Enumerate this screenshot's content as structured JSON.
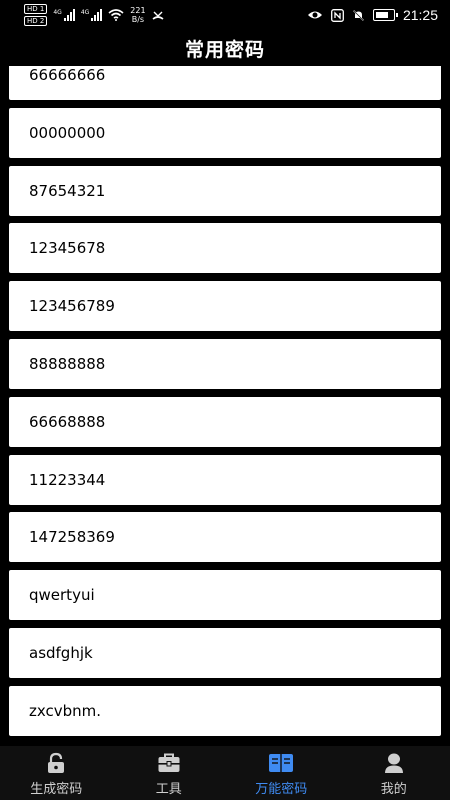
{
  "status_bar": {
    "sim1": "HD 1",
    "sim2": "HD 2",
    "net1": "4G",
    "net2": "4G",
    "speed_value": "221",
    "speed_unit": "B/s",
    "time": "21:25"
  },
  "header": {
    "title": "常用密码"
  },
  "passwords": [
    "66666666",
    "00000000",
    "87654321",
    "12345678",
    "123456789",
    "88888888",
    "66668888",
    "11223344",
    "147258369",
    "qwertyui",
    "asdfghjk",
    "zxcvbnm."
  ],
  "nav": {
    "items": [
      {
        "label": "生成密码",
        "icon": "lock-icon"
      },
      {
        "label": "工具",
        "icon": "toolbox-icon"
      },
      {
        "label": "万能密码",
        "icon": "book-icon"
      },
      {
        "label": "我的",
        "icon": "person-icon"
      }
    ],
    "active_color": "#3f8bf2"
  }
}
